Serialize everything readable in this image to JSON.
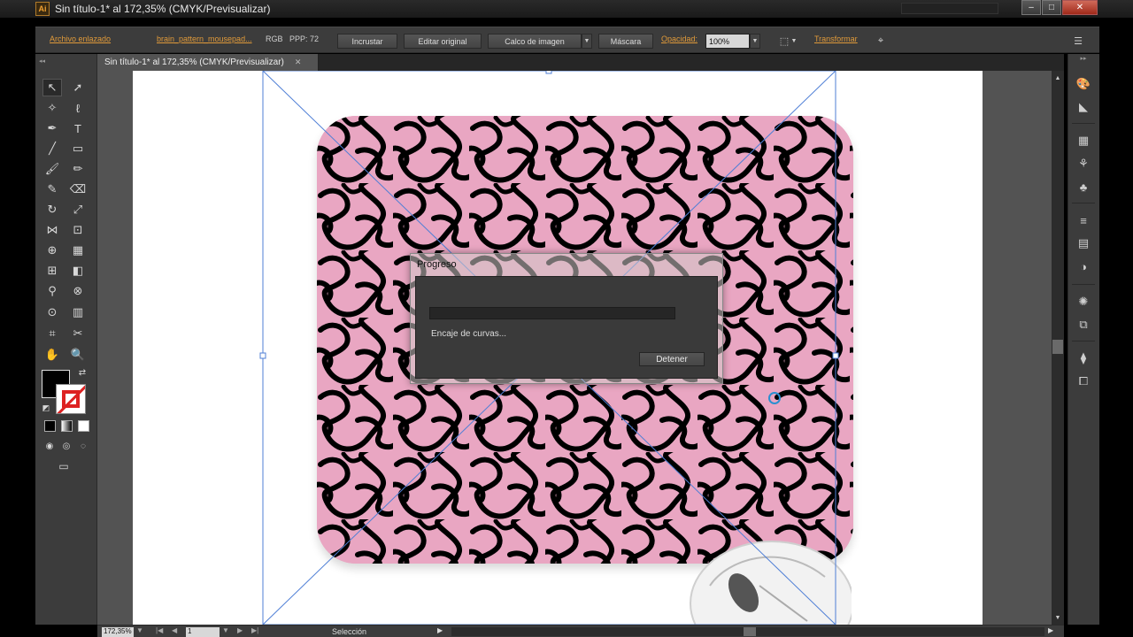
{
  "window": {
    "logo": "Ai",
    "title": "Sin título-1* al 172,35% (CMYK/Previsualizar)",
    "minimize": "–",
    "maximize": "□",
    "close": "✕"
  },
  "controlbar": {
    "linked_file_label": "Archivo enlazado",
    "file_name": "brain_pattern_mousepad...",
    "color_mode": "RGB",
    "ppi": "PPP: 72",
    "embed_button": "Incrustar",
    "edit_original_button": "Editar original",
    "image_trace_button": "Calco de imagen",
    "mask_button": "Máscara",
    "opacity_label": "Opacidad:",
    "opacity_value": "100%",
    "transform_label": "Transformar"
  },
  "document_tab": {
    "label": "Sin título-1* al 172,35% (CMYK/Previsualizar)",
    "close": "✕"
  },
  "dialog": {
    "title": "Progreso",
    "status": "Encaje de curvas...",
    "stop_button": "Detener",
    "progress": 0
  },
  "statusbar": {
    "zoom": "172,35%",
    "page": "1",
    "tool": "Selección"
  },
  "icons": {
    "selection": "selection-icon",
    "direct_selection": "direct-selection-icon"
  },
  "colors": {
    "accent_link": "#e09a3a",
    "panel_bg": "#3c3c3c",
    "canvas_bg": "#535353",
    "brain_pink": "#e9a6c2",
    "selection_blue": "#4f7fd6"
  }
}
